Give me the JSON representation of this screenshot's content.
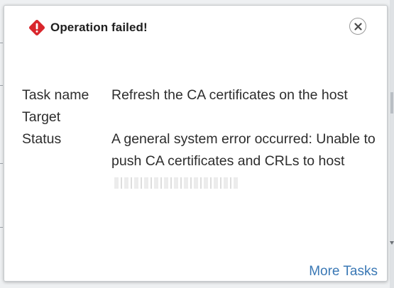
{
  "dialog": {
    "title": "Operation failed!",
    "icons": {
      "status": "error-diamond-icon",
      "close": "close-icon"
    },
    "colors": {
      "error": "#d9262c",
      "link": "#3a78b5"
    }
  },
  "details": {
    "task_name_label": "Task name",
    "task_name_value": "Refresh the CA certificates on the host",
    "target_label": "Target",
    "target_value": "",
    "status_label": "Status",
    "status_value": "A general system error occurred: Unable to push CA certificates and CRLs to host"
  },
  "footer": {
    "more_tasks_link": "More Tasks"
  }
}
